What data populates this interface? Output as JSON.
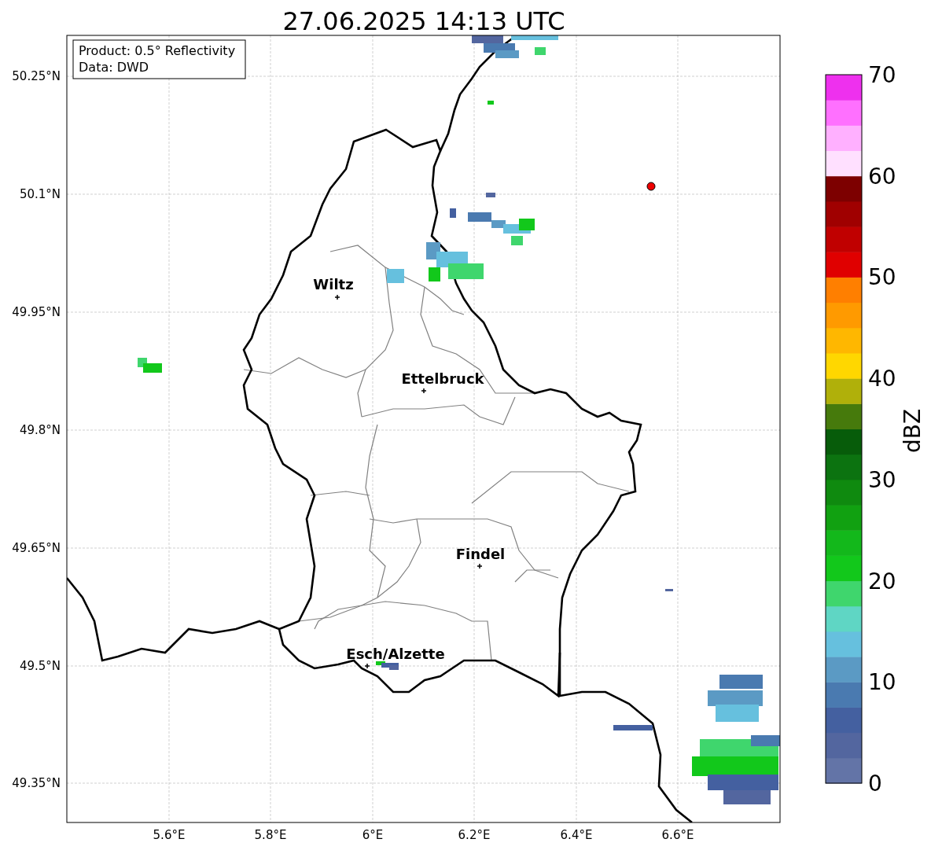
{
  "title": "27.06.2025 14:13 UTC",
  "info_box": {
    "lines": [
      "Product: 0.5° Reflectivity",
      "Data: DWD"
    ]
  },
  "map": {
    "y_ticks": [
      "50.25°N",
      "50.1°N",
      "49.95°N",
      "49.8°N",
      "49.65°N",
      "49.5°N",
      "49.35°N"
    ],
    "x_ticks": [
      "5.6°E",
      "5.8°E",
      "6°E",
      "6.2°E",
      "6.4°E",
      "6.6°E"
    ],
    "places": [
      {
        "name": "Wiltz"
      },
      {
        "name": "Ettelbruck"
      },
      {
        "name": "Findel"
      },
      {
        "name": "Esch/Alzette"
      }
    ]
  },
  "colorbar": {
    "label": "dBZ",
    "ticks": [
      "70",
      "60",
      "50",
      "40",
      "30",
      "20",
      "10",
      "0"
    ],
    "bins": [
      {
        "color": "#6374a7"
      },
      {
        "color": "#53669f"
      },
      {
        "color": "#4460a0"
      },
      {
        "color": "#4a7ab0"
      },
      {
        "color": "#5b9ac4"
      },
      {
        "color": "#66c0de"
      },
      {
        "color": "#5fd6c4"
      },
      {
        "color": "#3fd66d"
      },
      {
        "color": "#12c81b"
      },
      {
        "color": "#13b81b"
      },
      {
        "color": "#11a111"
      },
      {
        "color": "#0f8a0f"
      },
      {
        "color": "#0c7310"
      },
      {
        "color": "#075c0a"
      },
      {
        "color": "#467a0c"
      },
      {
        "color": "#b0b00a"
      },
      {
        "color": "#ffd700"
      },
      {
        "color": "#ffb700"
      },
      {
        "color": "#ff9a00"
      },
      {
        "color": "#ff7f00"
      },
      {
        "color": "#e00000"
      },
      {
        "color": "#c00000"
      },
      {
        "color": "#a00000"
      },
      {
        "color": "#7d0000"
      },
      {
        "color": "#ffe0ff"
      },
      {
        "color": "#ffb0ff"
      },
      {
        "color": "#ff70ff"
      },
      {
        "color": "#ee30ee"
      }
    ]
  }
}
